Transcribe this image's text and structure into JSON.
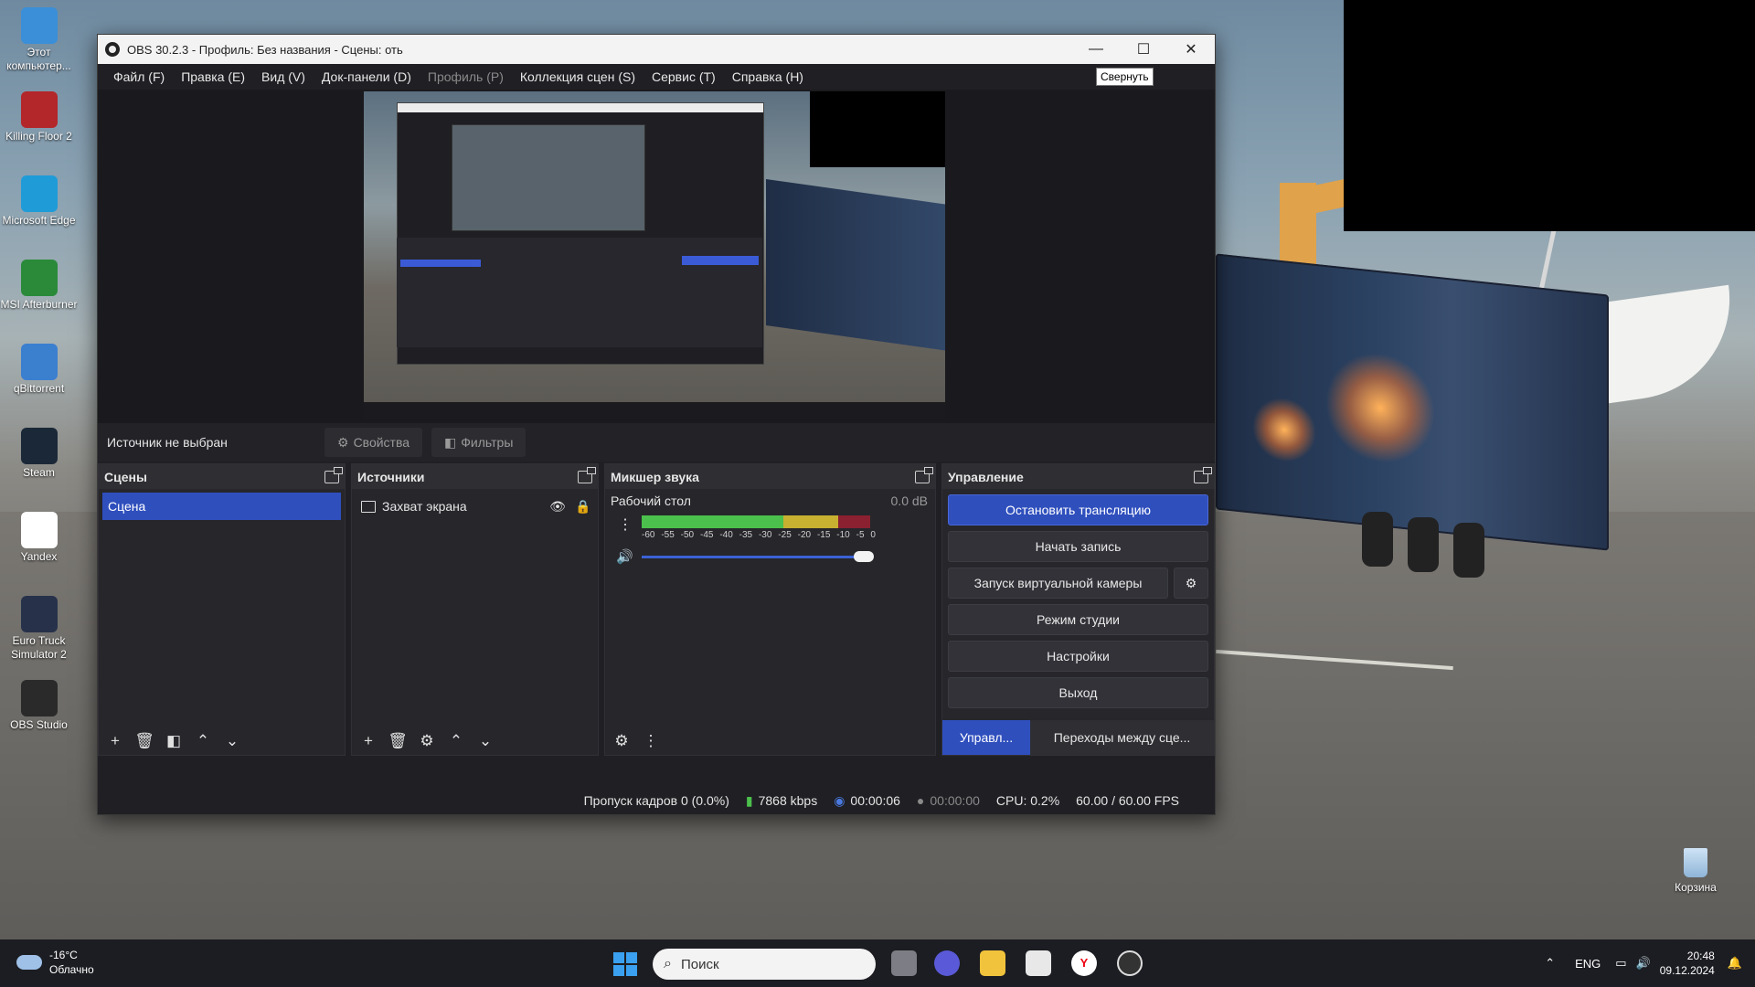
{
  "window": {
    "title": "OBS 30.2.3 - Профиль: Без названия - Сцены: оть",
    "tooltip": "Свернуть"
  },
  "menu": [
    "Файл (F)",
    "Правка (E)",
    "Вид (V)",
    "Док-панели (D)",
    "Профиль (P)",
    "Коллекция сцен (S)",
    "Сервис (T)",
    "Справка (H)"
  ],
  "source_bar": {
    "no_source": "Источник не выбран",
    "properties": "Свойства",
    "filters": "Фильтры"
  },
  "scenes": {
    "title": "Сцены",
    "items": [
      "Сцена"
    ]
  },
  "sources": {
    "title": "Источники",
    "items": [
      "Захват экрана"
    ]
  },
  "mixer": {
    "title": "Микшер звука",
    "channel": "Рабочий стол",
    "db": "0.0 dB",
    "ticks": [
      "-60",
      "-55",
      "-50",
      "-45",
      "-40",
      "-35",
      "-30",
      "-25",
      "-20",
      "-15",
      "-10",
      "-5",
      "0"
    ],
    "volume": 1.0
  },
  "controls": {
    "title": "Управление",
    "stop_stream": "Остановить трансляцию",
    "start_record": "Начать запись",
    "virtual_cam": "Запуск виртуальной камеры",
    "studio_mode": "Режим студии",
    "settings": "Настройки",
    "exit": "Выход",
    "tab_controls": "Управл...",
    "tab_transitions": "Переходы между сце..."
  },
  "status": {
    "dropped": "Пропуск кадров 0 (0.0%)",
    "bitrate": "7868 kbps",
    "stream_time": "00:00:06",
    "record_time": "00:00:00",
    "cpu": "CPU: 0.2%",
    "fps": "60.00 / 60.00 FPS"
  },
  "desktop_icons": [
    {
      "label": "Этот компьютер...",
      "icon": "computer-icon",
      "color": "#3a8fd8"
    },
    {
      "label": "Killing Floor 2",
      "icon": "killing-floor-icon",
      "color": "#b3262a"
    },
    {
      "label": "Microsoft Edge",
      "icon": "edge-icon",
      "color": "#1f9bd8"
    },
    {
      "label": "MSI Afterburner",
      "icon": "msi-afterburner-icon",
      "color": "#2a8a3a"
    },
    {
      "label": "qBittorrent",
      "icon": "qbittorrent-icon",
      "color": "#3b7fcf"
    },
    {
      "label": "Steam",
      "icon": "steam-icon",
      "color": "#1b2838"
    },
    {
      "label": "Yandex",
      "icon": "yandex-icon",
      "color": "#ffffff"
    },
    {
      "label": "Euro Truck Simulator 2",
      "icon": "ets2-icon",
      "color": "#27324a"
    },
    {
      "label": "OBS Studio",
      "icon": "obs-icon",
      "color": "#2a2a2a"
    }
  ],
  "recycle_bin": "Корзина",
  "taskbar": {
    "temp": "-16°C",
    "weather": "Облачно",
    "search": "Поиск",
    "lang": "ENG",
    "time": "20:48",
    "date": "09.12.2024"
  },
  "colors": {
    "accent": "#2f4fbd",
    "meter_green": "#4cc04c",
    "meter_yellow": "#c8b030",
    "meter_red": "#8a2030"
  }
}
